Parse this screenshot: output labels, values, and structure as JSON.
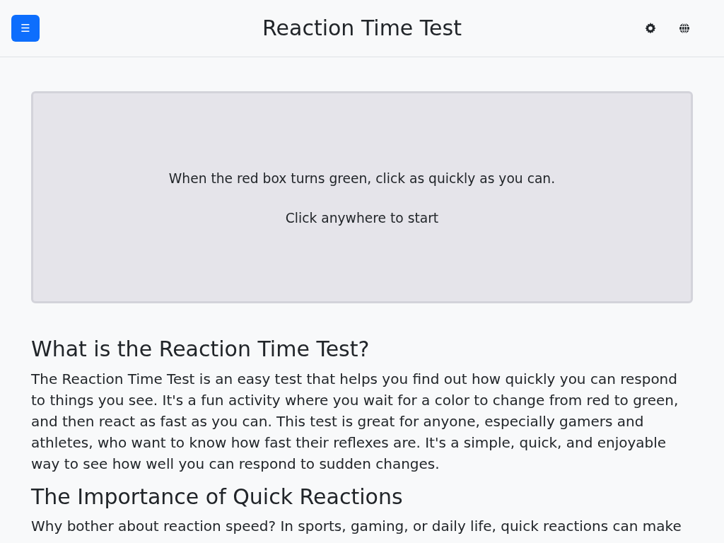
{
  "header": {
    "menu_button": "☰",
    "title": "Reaction Time Test"
  },
  "test_box": {
    "instruction": "When the red box turns green, click as quickly as you can.",
    "prompt": "Click anywhere to start"
  },
  "sections": [
    {
      "heading": "What is the Reaction Time Test?",
      "paragraphs": [
        "The Reaction Time Test is an easy test that helps you find out how quickly you can respond to things you see. It's a fun activity where you wait for a color to change from red to green, and then react as fast as you can. This test is great for anyone, especially gamers and athletes, who want to know how fast their reflexes are. It's a simple, quick, and enjoyable way to see how well you can respond to sudden changes."
      ]
    },
    {
      "heading": "The Importance of Quick Reactions",
      "paragraphs": [
        "Why bother about reaction speed? In sports, gaming, or daily life, quick reactions can make"
      ]
    }
  ]
}
